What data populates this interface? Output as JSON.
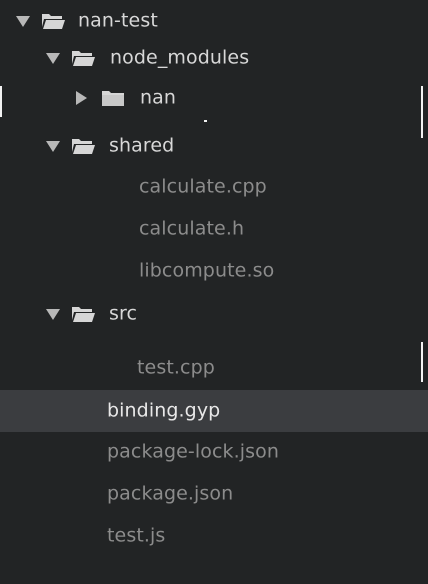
{
  "tree": {
    "root": {
      "label": "nan-test",
      "arrow_icon": "disclosure-down-icon",
      "folder_icon": "folder-open-icon"
    },
    "node_modules": {
      "label": "node_modules",
      "arrow_icon": "disclosure-down-icon",
      "folder_icon": "folder-open-icon"
    },
    "nan": {
      "label": "nan",
      "arrow_icon": "disclosure-right-icon",
      "folder_icon": "folder-closed-icon"
    },
    "shared": {
      "label": "shared",
      "arrow_icon": "disclosure-down-icon",
      "folder_icon": "folder-open-icon"
    },
    "shared_files": [
      "calculate.cpp",
      "calculate.h",
      "libcompute.so"
    ],
    "src": {
      "label": "src",
      "arrow_icon": "disclosure-down-icon",
      "folder_icon": "folder-open-icon"
    },
    "src_files": [
      "test.cpp"
    ],
    "root_files": [
      "binding.gyp",
      "package-lock.json",
      "package.json",
      "test.js"
    ],
    "selected_item": "binding.gyp"
  }
}
